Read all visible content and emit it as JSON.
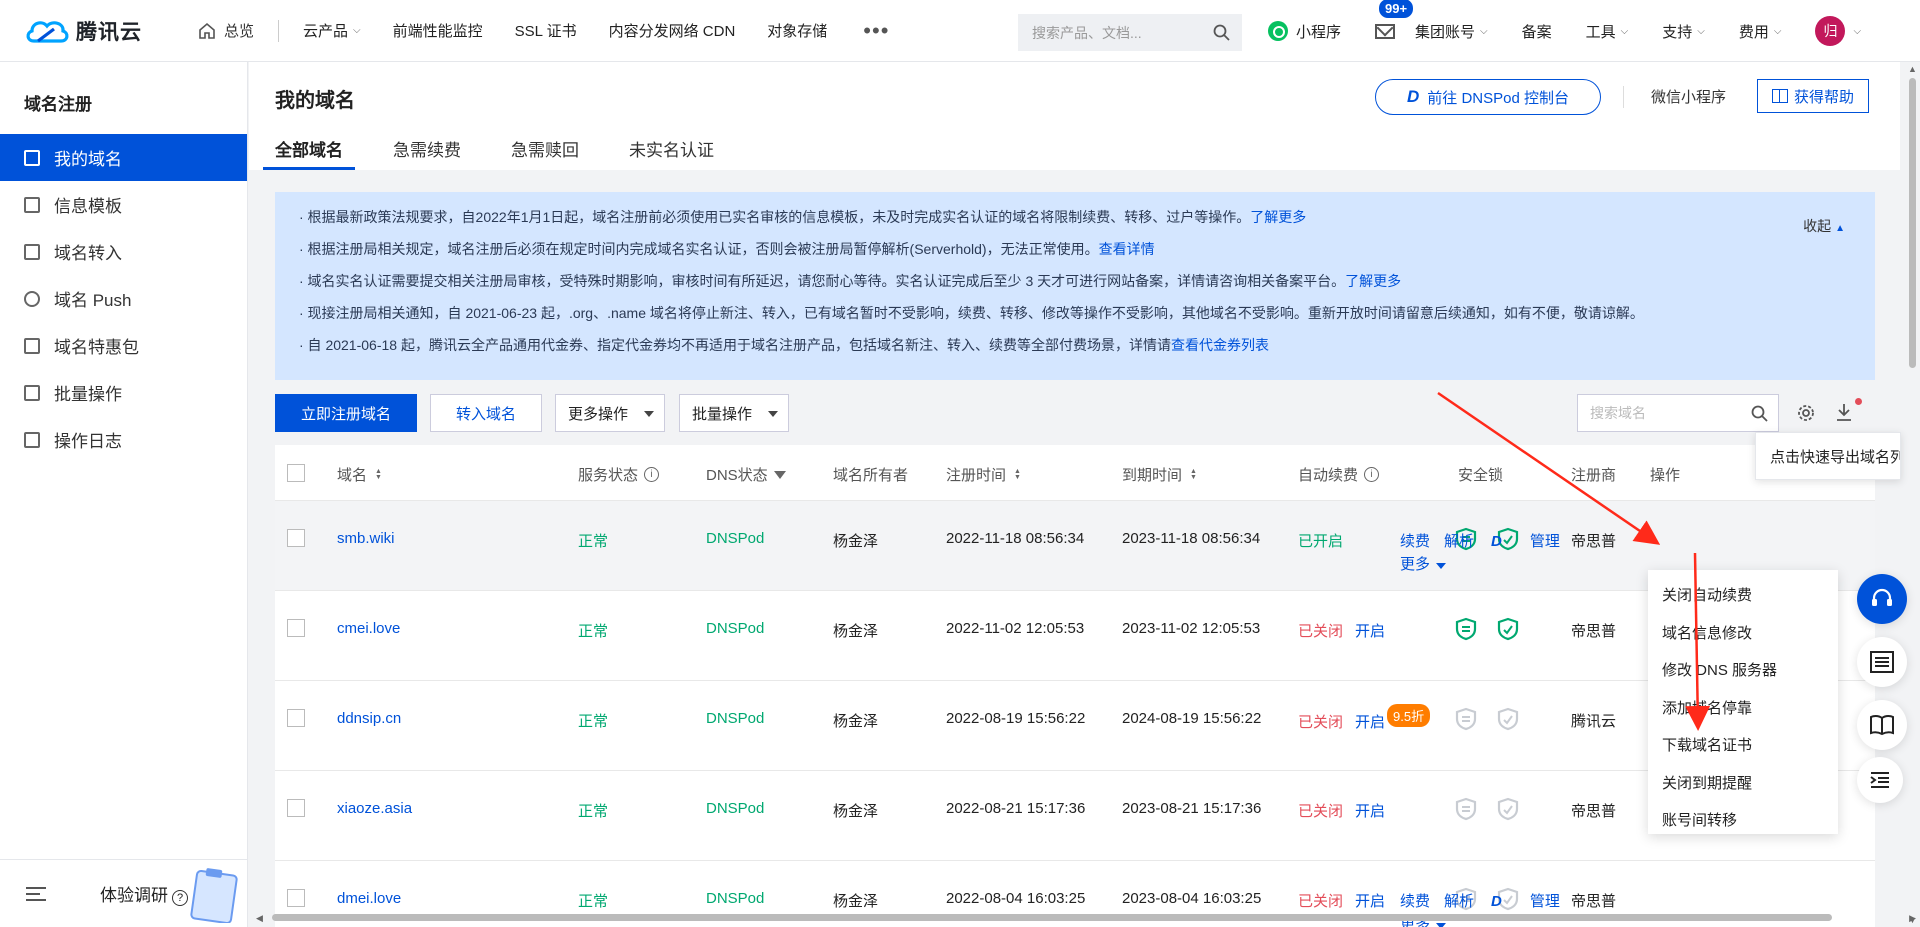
{
  "topnav": {
    "brand": "腾讯云",
    "home": "总览",
    "items": [
      {
        "label": "云产品",
        "caret": true
      },
      {
        "label": "前端性能监控",
        "caret": false
      },
      {
        "label": "SSL 证书",
        "caret": false
      },
      {
        "label": "内容分发网络 CDN",
        "caret": false
      },
      {
        "label": "对象存储",
        "caret": false
      }
    ],
    "more": "•••",
    "search_placeholder": "搜索产品、文档...",
    "miniprogram": "小程序",
    "mail_badge": "99+",
    "group_account": "集团账号",
    "filing": "备案",
    "tools": "工具",
    "support": "支持",
    "billing": "费用",
    "avatar": "归"
  },
  "sidebar": {
    "title": "域名注册",
    "items": [
      {
        "label": "我的域名",
        "active": true
      },
      {
        "label": "信息模板",
        "active": false
      },
      {
        "label": "域名转入",
        "active": false
      },
      {
        "label": "域名 Push",
        "active": false
      },
      {
        "label": "域名特惠包",
        "active": false
      },
      {
        "label": "批量操作",
        "active": false
      },
      {
        "label": "操作日志",
        "active": false
      }
    ],
    "survey": "体验调研"
  },
  "header": {
    "title": "我的域名",
    "dnspod_button": "前往 DNSPod 控制台",
    "wechat_mini": "微信小程序",
    "help_button": "获得帮助",
    "tabs": [
      "全部域名",
      "急需续费",
      "急需赎回",
      "未实名认证"
    ]
  },
  "notice": {
    "collapse": "收起",
    "lines": [
      {
        "text": "· 根据最新政策法规要求，自2022年1月1日起，域名注册前必须使用已实名审核的信息模板，未及时完成实名认证的域名将限制续费、转移、过户等操作。",
        "link": "了解更多"
      },
      {
        "text": "· 根据注册局相关规定，域名注册后必须在规定时间内完成域名实名认证，否则会被注册局暂停解析(Serverhold)，无法正常使用。",
        "link": "查看详情"
      },
      {
        "text": "· 域名实名认证需要提交相关注册局审核，受特殊时期影响，审核时间有所延迟，请您耐心等待。实名认证完成后至少 3 天才可进行网站备案，详情请咨询相关备案平台。",
        "link": "了解更多"
      },
      {
        "text": "· 现接注册局相关通知，自 2021-06-23 起，.org、.name 域名将停止新注、转入，已有域名暂时不受影响，续费、转移、修改等操作不受影响，其他域名不受影响。重新开放时间请留意后续通知，如有不便，敬请谅解。",
        "link": ""
      },
      {
        "text": "· 自 2021-06-18 起，腾讯云全产品通用代金券、指定代金券均不再适用于域名注册产品，包括域名新注、转入、续费等全部付费场景，详情请",
        "link": "查看代金券列表"
      }
    ]
  },
  "toolbar": {
    "register": "立即注册域名",
    "transfer": "转入域名",
    "more_ops": "更多操作",
    "batch_ops": "批量操作",
    "search_placeholder": "搜索域名",
    "export_tooltip": "点击快速导出域名列表"
  },
  "table": {
    "columns": [
      "域名",
      "服务状态",
      "DNS状态",
      "域名所有者",
      "注册时间",
      "到期时间",
      "自动续费",
      "安全锁",
      "注册商",
      "操作"
    ],
    "rows": [
      {
        "domain": "smb.wiki",
        "status": "正常",
        "dns": "DNSPod",
        "owner": "杨金泽",
        "reg": "2022-11-18 08:56:34",
        "exp": "2023-11-18 08:56:34",
        "auto": "已开启",
        "auto_on": true,
        "open": "",
        "discount": "",
        "lock": true,
        "registrar": "帝思普",
        "ops": true
      },
      {
        "domain": "cmei.love",
        "status": "正常",
        "dns": "DNSPod",
        "owner": "杨金泽",
        "reg": "2022-11-02 12:05:53",
        "exp": "2023-11-02 12:05:53",
        "auto": "已关闭",
        "auto_on": false,
        "open": "开启",
        "discount": "",
        "lock": true,
        "registrar": "帝思普",
        "ops": false
      },
      {
        "domain": "ddnsip.cn",
        "status": "正常",
        "dns": "DNSPod",
        "owner": "杨金泽",
        "reg": "2022-08-19 15:56:22",
        "exp": "2024-08-19 15:56:22",
        "auto": "已关闭",
        "auto_on": false,
        "open": "开启",
        "discount": "9.5折",
        "lock": false,
        "registrar": "腾讯云",
        "ops": false
      },
      {
        "domain": "xiaoze.asia",
        "status": "正常",
        "dns": "DNSPod",
        "owner": "杨金泽",
        "reg": "2022-08-21 15:17:36",
        "exp": "2023-08-21 15:17:36",
        "auto": "已关闭",
        "auto_on": false,
        "open": "开启",
        "discount": "",
        "lock": false,
        "registrar": "帝思普",
        "ops": false
      },
      {
        "domain": "dmei.love",
        "status": "正常",
        "dns": "DNSPod",
        "owner": "杨金泽",
        "reg": "2022-08-04 16:03:25",
        "exp": "2023-08-04 16:03:25",
        "auto": "已关闭",
        "auto_on": false,
        "open": "开启",
        "discount": "",
        "lock": false,
        "registrar": "帝思普",
        "ops": true
      }
    ],
    "ops": {
      "renew": "续费",
      "resolve": "解析",
      "manage": "管理",
      "more": "更多"
    }
  },
  "dropdown": {
    "items": [
      "关闭自动续费",
      "域名信息修改",
      "修改 DNS 服务器",
      "添加域名停靠",
      "下载域名证书",
      "关闭到期提醒",
      "账号间转移"
    ]
  },
  "colors": {
    "brand": "#0052d9",
    "success": "#00a870",
    "danger": "#e34d59",
    "notice_bg": "#d4e6ff",
    "arrow": "#ff2a1a",
    "discount": "#ff7d00"
  },
  "icons": [
    "tencent-cloud-logo",
    "home-icon",
    "search-icon",
    "miniprogram-icon",
    "mail-icon",
    "avatar",
    "shield-lock-icon",
    "gear-icon",
    "download-icon",
    "headset-icon",
    "list-icon",
    "book-icon",
    "indent-icon"
  ]
}
